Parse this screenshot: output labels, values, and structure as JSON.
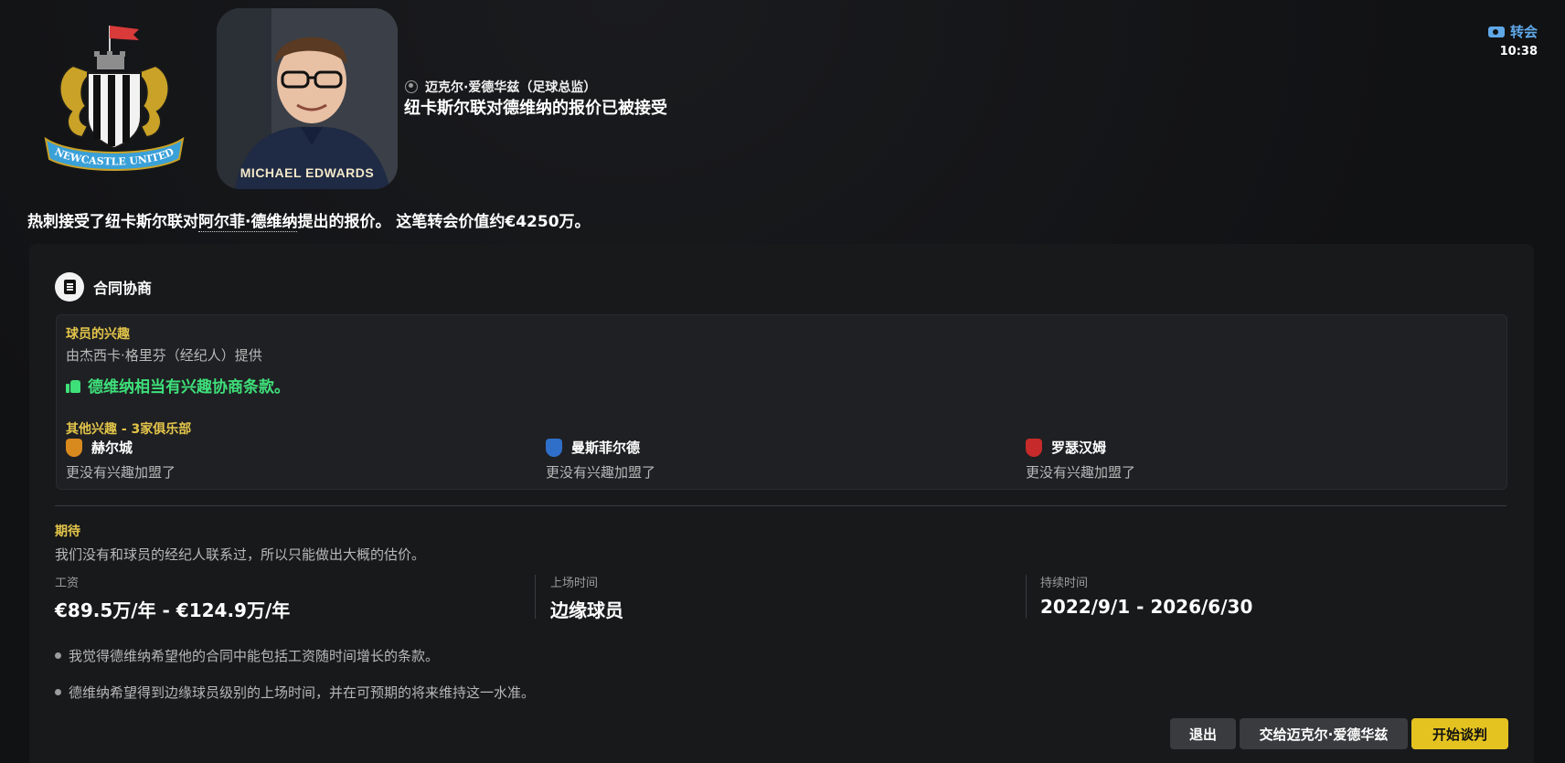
{
  "header": {
    "crest_icon": "newcastle-united-crest",
    "crest_text": "NEWCASTLE UNITED",
    "portrait_caption": "MICHAEL EDWARDS",
    "sender": "迈克尔·爱德华兹（足球总监）",
    "headline": "纽卡斯尔联对德维纳的报价已被接受",
    "category": "转会",
    "time": "10:38"
  },
  "summary": {
    "part1": "热刺接受了纽卡斯尔联对",
    "player": "阿尔菲·德维纳",
    "part2": "提出的报价。 这笔转会价值约€4250万。"
  },
  "contract": {
    "section_title": "合同协商",
    "interest": {
      "title": "球员的兴趣",
      "agent": "由杰西卡·格里芬（经纪人）提供",
      "positive": "德维纳相当有兴趣协商条款。",
      "other_title": "其他兴趣 - 3家俱乐部",
      "clubs": [
        {
          "name": "赫尔城",
          "status": "更没有兴趣加盟了",
          "color": "#d98a1f"
        },
        {
          "name": "曼斯菲尔德",
          "status": "更没有兴趣加盟了",
          "color": "#2f6fc9"
        },
        {
          "name": "罗瑟汉姆",
          "status": "更没有兴趣加盟了",
          "color": "#c62a2a"
        }
      ]
    },
    "expectation": {
      "title": "期待",
      "description": "我们没有和球员的经纪人联系过，所以只能做出大概的估价。",
      "wage_label": "工资",
      "wage_value": "€89.5万/年 - €124.9万/年",
      "playtime_label": "上场时间",
      "playtime_value": "边缘球员",
      "duration_label": "持续时间",
      "duration_value": "2022/9/1 - 2026/6/30",
      "notes": [
        "我觉得德维纳希望他的合同中能包括工资随时间增长的条款。",
        "德维纳希望得到边缘球员级别的上场时间，并在可预期的将来维持这一水准。"
      ]
    }
  },
  "actions": {
    "exit": "退出",
    "delegate": "交给迈克尔·爱德华兹",
    "start": "开始谈判"
  },
  "colors": {
    "accent_yellow": "#e4c321",
    "positive_green": "#3ee07a",
    "label_yellow": "#e3c54a",
    "transfer_blue": "#5fa8e8"
  }
}
